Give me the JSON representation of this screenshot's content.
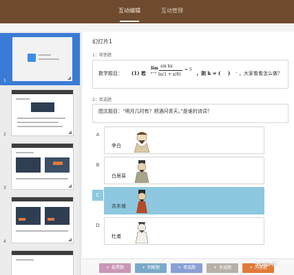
{
  "nav": {
    "tabs": [
      {
        "label": "互动编辑",
        "active": true
      },
      {
        "label": "互动管理",
        "active": false
      }
    ]
  },
  "sidebar": {
    "thumbnails": [
      {
        "number": "1",
        "selected": true
      },
      {
        "number": "2",
        "selected": false
      },
      {
        "number": "3",
        "selected": false
      },
      {
        "number": "4",
        "selected": false
      }
    ],
    "accent_color": "#3a7bd5"
  },
  "slide": {
    "title": "幻灯片1",
    "q1": {
      "label": "1：简答题",
      "prefix": "数学题目：",
      "if_word": "(1) 若",
      "lim_text": "lim",
      "lim_sub": "x→0",
      "num": "sin kx",
      "den": "ln(1 + x/8)",
      "eq": "= 5",
      "then": "，则 k = (",
      "close": ")",
      "suffix": "，大家看看怎么做？"
    },
    "q2": {
      "label": "2：单选题",
      "text": "图文题目：“明月几时有？把酒问青天。”是谁的诗词？"
    },
    "options": [
      {
        "letter": "A",
        "name": "李白",
        "selected": false
      },
      {
        "letter": "B",
        "name": "白居易",
        "selected": false
      },
      {
        "letter": "C",
        "name": "苏东坡",
        "selected": true
      },
      {
        "letter": "D",
        "name": "杜甫",
        "selected": false
      }
    ],
    "selected_color": "#8dc8e0"
  },
  "toolbar": {
    "buttons": [
      {
        "label": "投票题",
        "color": "#c996b4"
      },
      {
        "label": "判断题",
        "color": "#7aa9c9"
      },
      {
        "label": "单选题",
        "color": "#8a9fd6"
      },
      {
        "label": "多选题",
        "color": "#b7b0a8"
      },
      {
        "label": "问答题",
        "color": "#e07b39"
      }
    ]
  },
  "watermark": "9GAME",
  "colors": {
    "topbar": "#6e4a2e",
    "background": "#f4f4f4"
  }
}
